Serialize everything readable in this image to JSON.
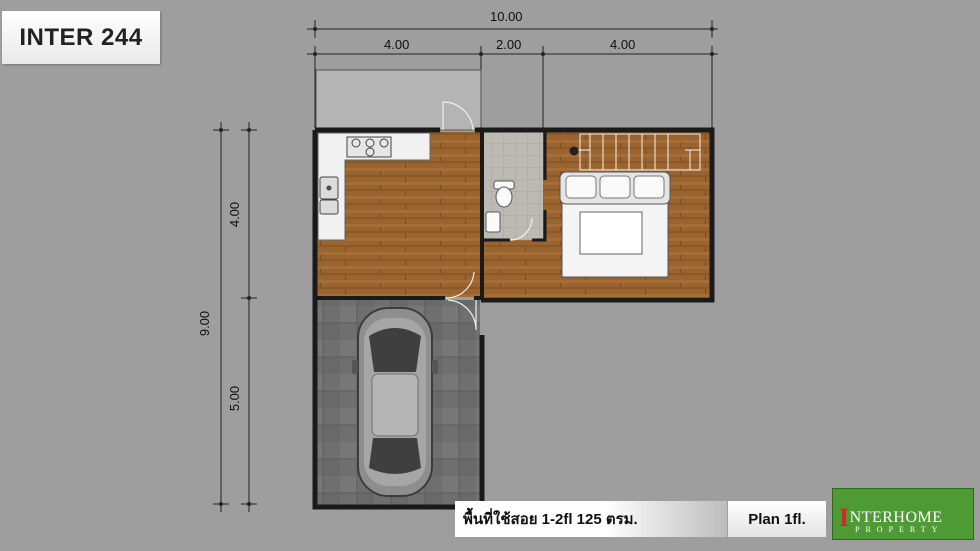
{
  "title": "INTER 244",
  "dimensions": {
    "top_total": "10.00",
    "top_left": "4.00",
    "top_middle": "2.00",
    "top_right": "4.00",
    "left_total": "9.00",
    "left_upper": "4.00",
    "left_lower": "5.00"
  },
  "footer": {
    "area_text": "พื้นที่ใช้สอย 1-2fl   125 ตรม.",
    "plan_label": "Plan 1fl."
  },
  "logo": {
    "initial": "I",
    "name": "NTERHOME",
    "sub": "PROPERTY"
  },
  "colors": {
    "background": "#9e9e9e",
    "wood_floor": "#9a6430",
    "wall": "#1a1a1a",
    "garage_tile": "#6f6f6f",
    "logo_green": "#4e9b35"
  }
}
